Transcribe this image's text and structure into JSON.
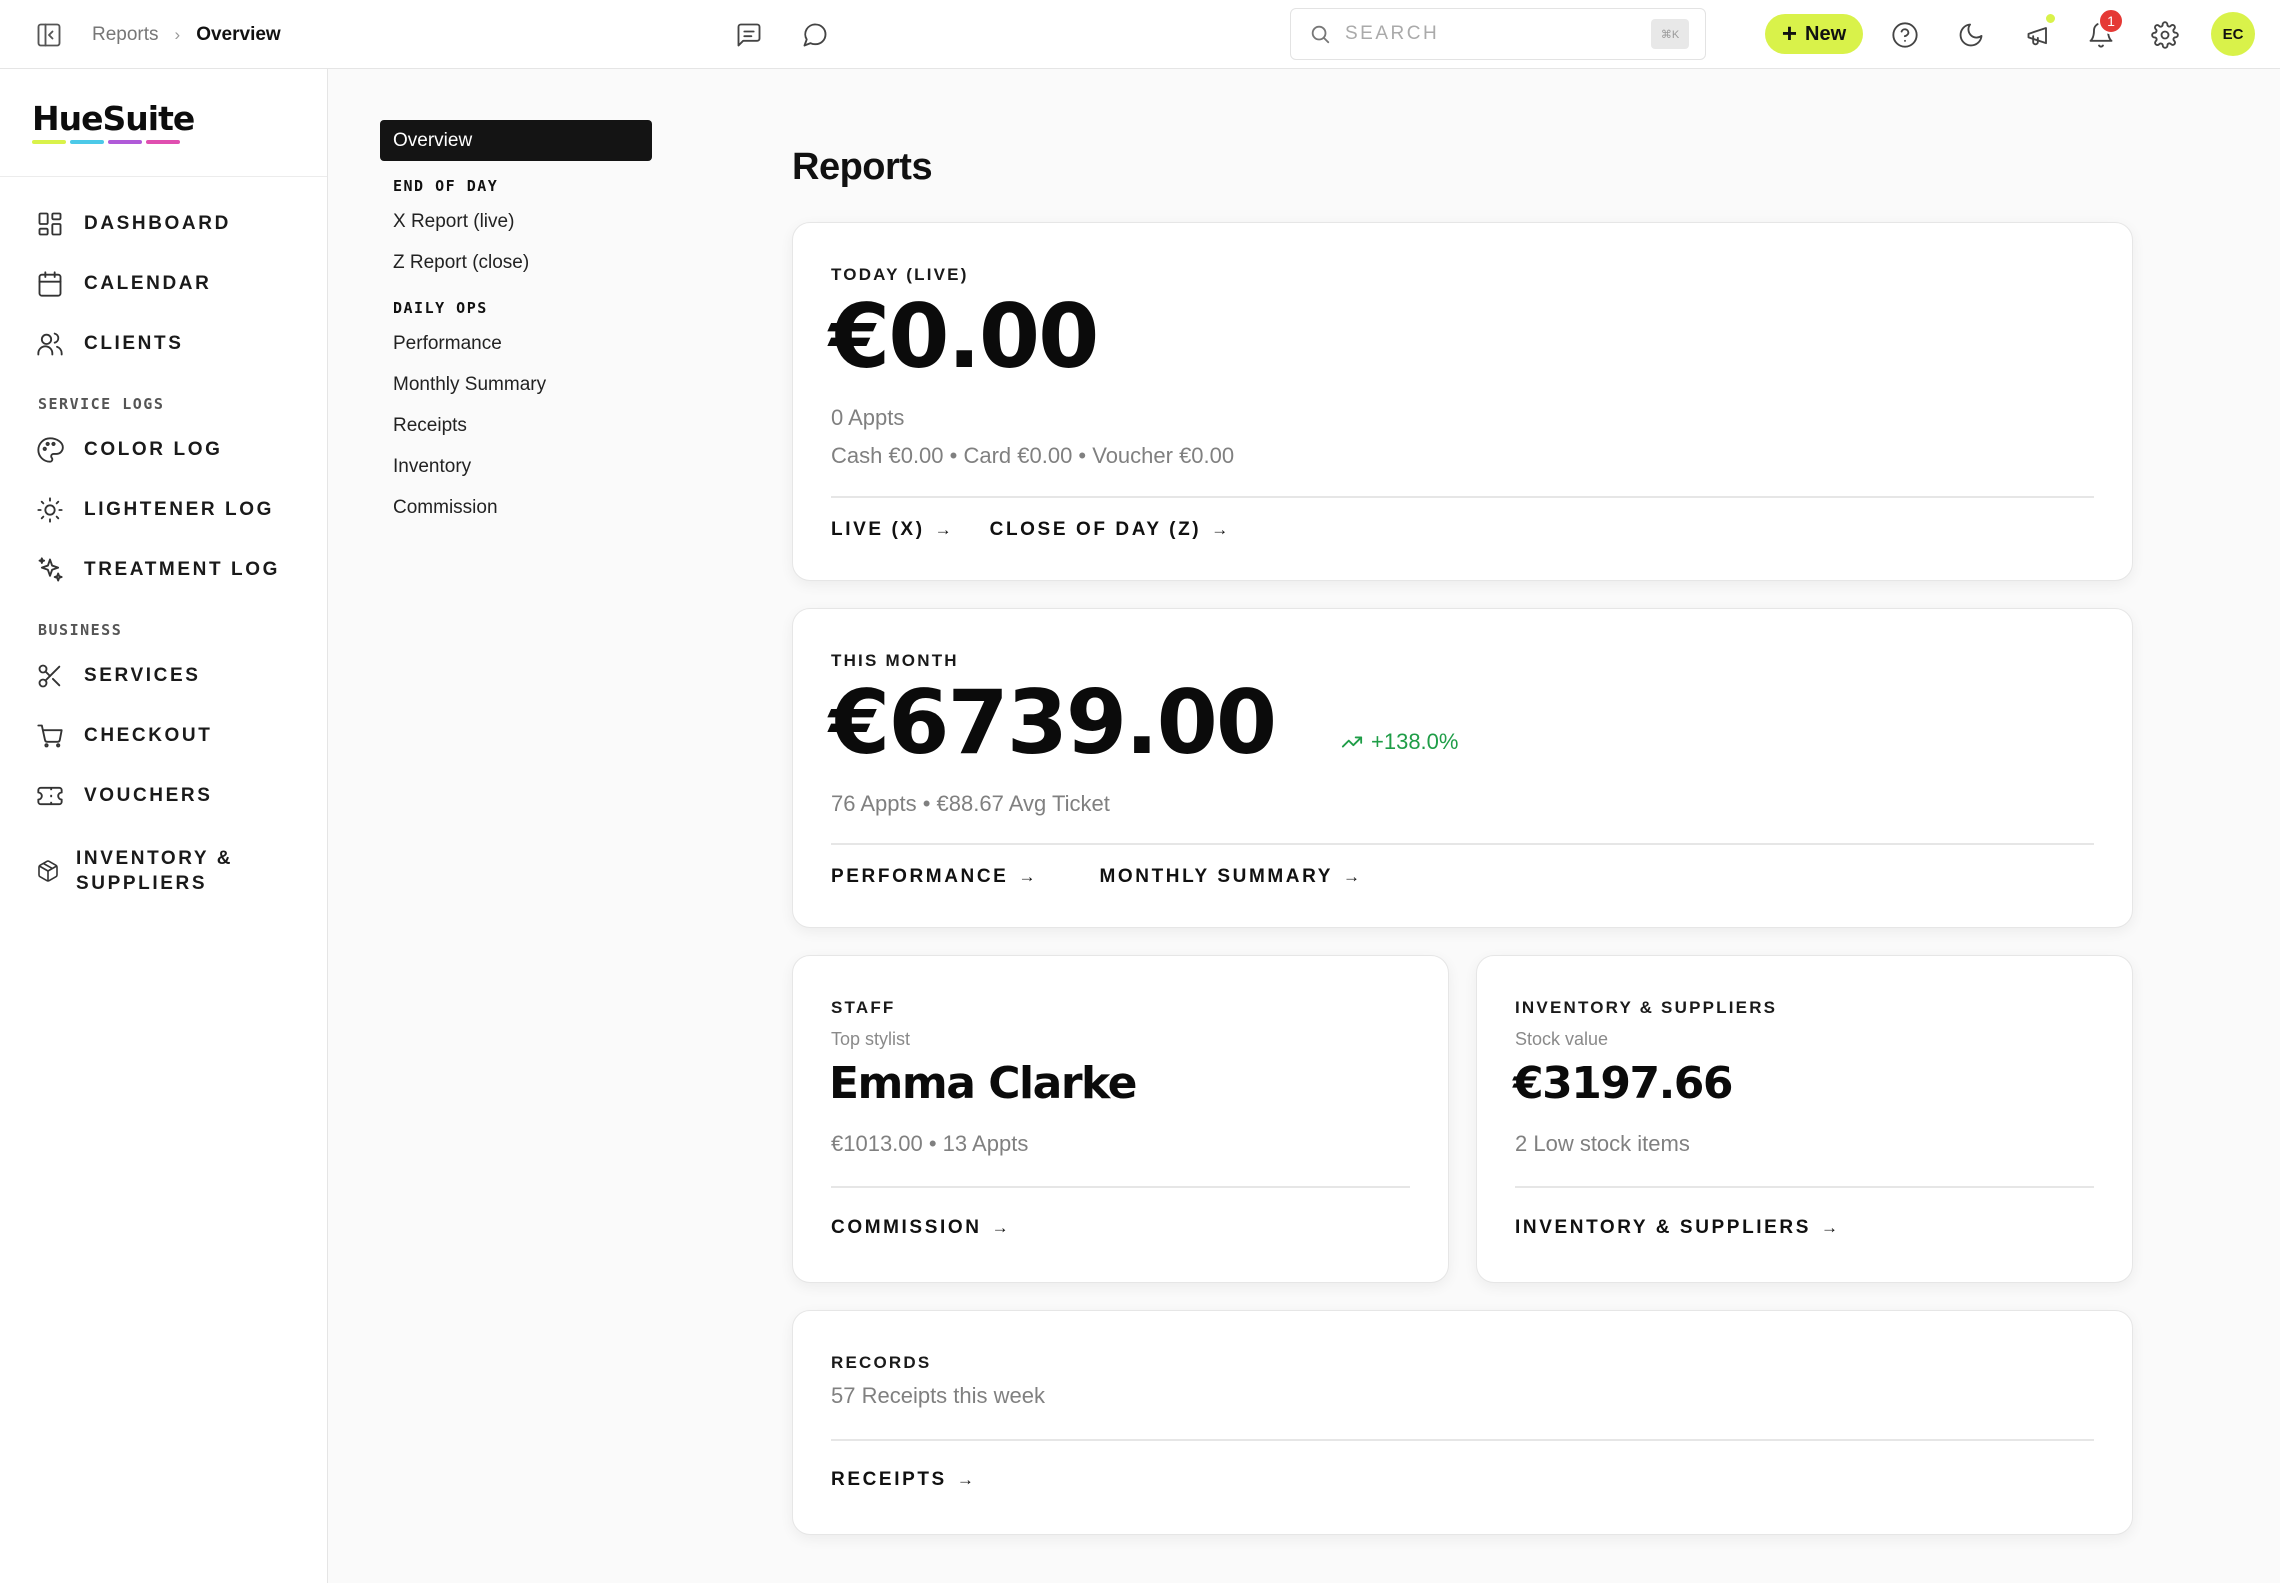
{
  "topbar": {
    "breadcrumb_parent": "Reports",
    "breadcrumb_current": "Overview",
    "search_placeholder": "SEARCH",
    "search_shortcut": "⌘K",
    "new_button": "New",
    "notification_count": "1",
    "avatar_initials": "EC",
    "accent_color": "#d9f24a"
  },
  "sidebar": {
    "logo": "HueSuite",
    "logo_colors": [
      "#d9f24a",
      "#4cc9e8",
      "#b05ad8",
      "#e04fb0"
    ],
    "items": [
      {
        "label": "DASHBOARD",
        "icon": "grid-icon"
      },
      {
        "label": "CALENDAR",
        "icon": "calendar-icon"
      },
      {
        "label": "CLIENTS",
        "icon": "users-icon"
      }
    ],
    "section_service_logs": "SERVICE LOGS",
    "service_logs": [
      {
        "label": "COLOR LOG",
        "icon": "palette-icon"
      },
      {
        "label": "LIGHTENER LOG",
        "icon": "sun-icon"
      },
      {
        "label": "TREATMENT LOG",
        "icon": "sparkles-icon"
      }
    ],
    "section_business": "BUSINESS",
    "business": [
      {
        "label": "SERVICES",
        "icon": "scissors-icon"
      },
      {
        "label": "CHECKOUT",
        "icon": "cart-icon"
      },
      {
        "label": "VOUCHERS",
        "icon": "ticket-icon"
      },
      {
        "label_line1": "INVENTORY &",
        "label_line2": "SUPPLIERS",
        "icon": "box-icon"
      }
    ]
  },
  "subnav": {
    "active": "Overview",
    "section_end_of_day": "END OF DAY",
    "end_of_day": [
      "X Report (live)",
      "Z Report (close)"
    ],
    "section_daily_ops": "DAILY OPS",
    "daily_ops": [
      "Performance",
      "Monthly Summary",
      "Receipts",
      "Inventory",
      "Commission"
    ]
  },
  "main": {
    "title": "Reports",
    "today": {
      "label": "TODAY (LIVE)",
      "value": "€0.00",
      "appts": "0 Appts",
      "breakdown": "Cash €0.00 • Card €0.00 • Voucher €0.00",
      "link1": "LIVE (X)",
      "link2": "CLOSE OF DAY (Z)"
    },
    "month": {
      "label": "THIS MONTH",
      "value": "€6739.00",
      "trend": "+138.0%",
      "trend_color": "#1f9d47",
      "detail": "76 Appts • €88.67 Avg Ticket",
      "link1": "PERFORMANCE",
      "link2": "MONTHLY SUMMARY"
    },
    "staff": {
      "label": "STAFF",
      "sublabel": "Top stylist",
      "value": "Emma Clarke",
      "detail": "€1013.00 • 13 Appts",
      "link": "COMMISSION"
    },
    "inventory": {
      "label": "INVENTORY & SUPPLIERS",
      "sublabel": "Stock value",
      "value": "€3197.66",
      "detail": "2 Low stock items",
      "link": "INVENTORY & SUPPLIERS"
    },
    "records": {
      "label": "RECORDS",
      "detail": "57 Receipts this week",
      "link": "RECEIPTS"
    },
    "arrow": "→"
  }
}
